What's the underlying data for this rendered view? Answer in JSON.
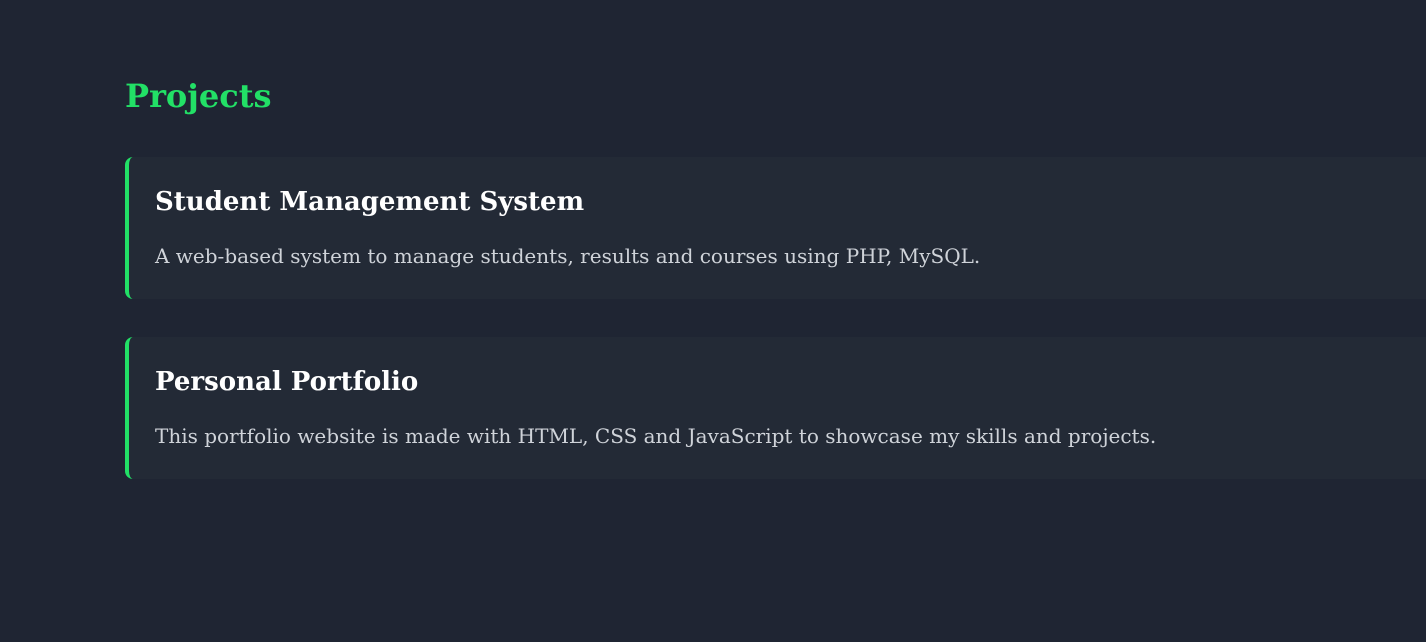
{
  "projects_section": {
    "title": "Projects",
    "items": [
      {
        "title": "Student Management System",
        "description": "A web-based system to manage students, results and courses using PHP, MySQL."
      },
      {
        "title": "Personal Portfolio",
        "description": "This portfolio website is made with HTML, CSS and JavaScript to showcase my skills and projects."
      }
    ]
  },
  "colors": {
    "background": "#1f2533",
    "card_background": "#232a36",
    "accent": "#22e066",
    "heading_text": "#ffffff",
    "body_text": "#cfd3d9"
  }
}
